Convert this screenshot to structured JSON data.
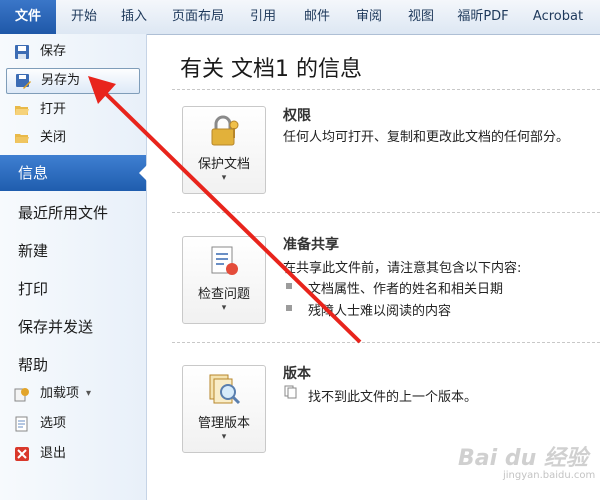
{
  "ribbon": {
    "tabs": [
      "文件",
      "开始",
      "插入",
      "页面布局",
      "引用",
      "邮件",
      "审阅",
      "视图",
      "福昕PDF",
      "Acrobat"
    ]
  },
  "left_pane": {
    "commands": [
      {
        "label": "保存",
        "icon": "save-icon"
      },
      {
        "label": "另存为",
        "icon": "save-as-icon"
      },
      {
        "label": "打开",
        "icon": "open-folder-icon"
      },
      {
        "label": "关闭",
        "icon": "close-document-icon"
      }
    ],
    "selected": "信息",
    "nav": [
      "最近所用文件",
      "新建",
      "打印",
      "保存并发送",
      "帮助"
    ],
    "tools": [
      {
        "label": "加载项",
        "icon": "addins-icon",
        "dropdown": "▾"
      },
      {
        "label": "选项",
        "icon": "options-icon"
      },
      {
        "label": "退出",
        "icon": "exit-icon"
      }
    ]
  },
  "main": {
    "title": "有关 文档1 的信息",
    "sections": {
      "permissions": {
        "button_label": "保护文档",
        "dropdown": "▾",
        "heading": "权限",
        "text": "任何人均可打开、复制和更改此文档的任何部分。"
      },
      "prepare": {
        "button_label": "检查问题",
        "dropdown": "▾",
        "heading": "准备共享",
        "text": "在共享此文件前，请注意其包含以下内容:",
        "bullets": [
          "文档属性、作者的姓名和相关日期",
          "残障人士难以阅读的内容"
        ]
      },
      "versions": {
        "button_label": "管理版本",
        "dropdown": "▾",
        "heading": "版本",
        "text": "找不到此文件的上一个版本。"
      }
    }
  },
  "annotation": {
    "arrow_color": "#e8241c"
  },
  "watermark": {
    "text": "Bai du 经验",
    "sub": "jingyan.baidu.com"
  }
}
